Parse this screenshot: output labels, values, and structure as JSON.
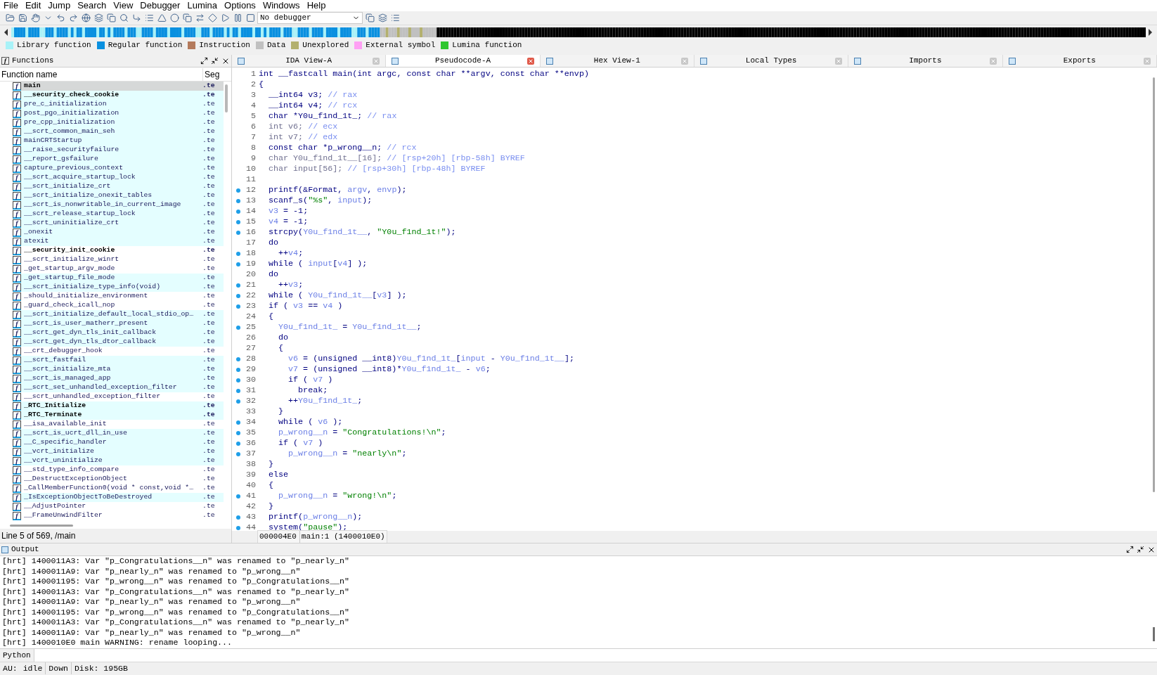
{
  "menu": [
    "File",
    "Edit",
    "Jump",
    "Search",
    "View",
    "Debugger",
    "Lumina",
    "Options",
    "Windows",
    "Help"
  ],
  "toolbar": {
    "debugger": "No debugger"
  },
  "legend": [
    {
      "label": "Library function",
      "color": "#a8f2f8"
    },
    {
      "label": "Regular function",
      "color": "#0a90e0"
    },
    {
      "label": "Instruction",
      "color": "#b47a5c"
    },
    {
      "label": "Data",
      "color": "#c0c0c0"
    },
    {
      "label": "Unexplored",
      "color": "#b3b06e"
    },
    {
      "label": "External symbol",
      "color": "#ffa0f4"
    },
    {
      "label": "Lumina function",
      "color": "#2ec62e"
    }
  ],
  "functions_panel": {
    "title": "Functions",
    "glyph": "f",
    "columns": [
      "Function name",
      "Seg"
    ],
    "status": "Line 5 of 569, /main",
    "rows": [
      {
        "glyph": "f",
        "name": "main",
        "segment": ".te",
        "bold": true,
        "library": true,
        "selected": true
      },
      {
        "glyph": "f",
        "name": "__security_check_cookie",
        "segment": ".te",
        "bold": true,
        "library": true,
        "selected": false
      },
      {
        "glyph": "f",
        "name": "pre_c_initialization",
        "segment": ".te",
        "bold": false,
        "library": true,
        "selected": false
      },
      {
        "glyph": "f",
        "name": "post_pgo_initialization",
        "segment": ".te",
        "bold": false,
        "library": true,
        "selected": false
      },
      {
        "glyph": "f",
        "name": "pre_cpp_initialization",
        "segment": ".te",
        "bold": false,
        "library": true,
        "selected": false
      },
      {
        "glyph": "f",
        "name": "__scrt_common_main_seh",
        "segment": ".te",
        "bold": false,
        "library": true,
        "selected": false
      },
      {
        "glyph": "f",
        "name": "mainCRTStartup",
        "segment": ".te",
        "bold": false,
        "library": true,
        "selected": false
      },
      {
        "glyph": "f",
        "name": "__raise_securityfailure",
        "segment": ".te",
        "bold": false,
        "library": true,
        "selected": false
      },
      {
        "glyph": "f",
        "name": "__report_gsfailure",
        "segment": ".te",
        "bold": false,
        "library": true,
        "selected": false
      },
      {
        "glyph": "f",
        "name": "capture_previous_context",
        "segment": ".te",
        "bold": false,
        "library": true,
        "selected": false
      },
      {
        "glyph": "f",
        "name": "__scrt_acquire_startup_lock",
        "segment": ".te",
        "bold": false,
        "library": true,
        "selected": false
      },
      {
        "glyph": "f",
        "name": "__scrt_initialize_crt",
        "segment": ".te",
        "bold": false,
        "library": true,
        "selected": false
      },
      {
        "glyph": "f",
        "name": "__scrt_initialize_onexit_tables",
        "segment": ".te",
        "bold": false,
        "library": true,
        "selected": false
      },
      {
        "glyph": "f",
        "name": "__scrt_is_nonwritable_in_current_image",
        "segment": ".te",
        "bold": false,
        "library": true,
        "selected": false
      },
      {
        "glyph": "f",
        "name": "__scrt_release_startup_lock",
        "segment": ".te",
        "bold": false,
        "library": true,
        "selected": false
      },
      {
        "glyph": "f",
        "name": "__scrt_uninitialize_crt",
        "segment": ".te",
        "bold": false,
        "library": true,
        "selected": false
      },
      {
        "glyph": "f",
        "name": "_onexit",
        "segment": ".te",
        "bold": false,
        "library": true,
        "selected": false
      },
      {
        "glyph": "f",
        "name": "atexit",
        "segment": ".te",
        "bold": false,
        "library": true,
        "selected": false
      },
      {
        "glyph": "f",
        "name": "__security_init_cookie",
        "segment": ".te",
        "bold": true,
        "library": false,
        "selected": false
      },
      {
        "glyph": "f",
        "name": "__scrt_initialize_winrt",
        "segment": ".te",
        "bold": false,
        "library": false,
        "selected": false
      },
      {
        "glyph": "f",
        "name": "_get_startup_argv_mode",
        "segment": ".te",
        "bold": false,
        "library": false,
        "selected": false
      },
      {
        "glyph": "f",
        "name": "_get_startup_file_mode",
        "segment": ".te",
        "bold": false,
        "library": true,
        "selected": false
      },
      {
        "glyph": "f",
        "name": "__scrt_initialize_type_info(void)",
        "segment": ".te",
        "bold": false,
        "library": true,
        "selected": false
      },
      {
        "glyph": "f",
        "name": "_should_initialize_environment",
        "segment": ".te",
        "bold": false,
        "library": false,
        "selected": false
      },
      {
        "glyph": "f",
        "name": "_guard_check_icall_nop",
        "segment": ".te",
        "bold": false,
        "library": false,
        "selected": false
      },
      {
        "glyph": "f",
        "name": "__scrt_initialize_default_local_stdio_op…",
        "segment": ".te",
        "bold": false,
        "library": true,
        "selected": false
      },
      {
        "glyph": "f",
        "name": "__scrt_is_user_matherr_present",
        "segment": ".te",
        "bold": false,
        "library": true,
        "selected": false
      },
      {
        "glyph": "f",
        "name": "__scrt_get_dyn_tls_init_callback",
        "segment": ".te",
        "bold": false,
        "library": true,
        "selected": false
      },
      {
        "glyph": "f",
        "name": "__scrt_get_dyn_tls_dtor_callback",
        "segment": ".te",
        "bold": false,
        "library": true,
        "selected": false
      },
      {
        "glyph": "f",
        "name": "__crt_debugger_hook",
        "segment": ".te",
        "bold": false,
        "library": false,
        "selected": false
      },
      {
        "glyph": "f",
        "name": "__scrt_fastfail",
        "segment": ".te",
        "bold": false,
        "library": true,
        "selected": false
      },
      {
        "glyph": "f",
        "name": "__scrt_initialize_mta",
        "segment": ".te",
        "bold": false,
        "library": true,
        "selected": false
      },
      {
        "glyph": "f",
        "name": "__scrt_is_managed_app",
        "segment": ".te",
        "bold": false,
        "library": true,
        "selected": false
      },
      {
        "glyph": "f",
        "name": "__scrt_set_unhandled_exception_filter",
        "segment": ".te",
        "bold": false,
        "library": true,
        "selected": false
      },
      {
        "glyph": "f",
        "name": "__scrt_unhandled_exception_filter",
        "segment": ".te",
        "bold": false,
        "library": false,
        "selected": false
      },
      {
        "glyph": "f",
        "name": "_RTC_Initialize",
        "segment": ".te",
        "bold": true,
        "library": true,
        "selected": false
      },
      {
        "glyph": "f",
        "name": "_RTC_Terminate",
        "segment": ".te",
        "bold": true,
        "library": true,
        "selected": false
      },
      {
        "glyph": "f",
        "name": "__isa_available_init",
        "segment": ".te",
        "bold": false,
        "library": false,
        "selected": false
      },
      {
        "glyph": "f",
        "name": "__scrt_is_ucrt_dll_in_use",
        "segment": ".te",
        "bold": false,
        "library": true,
        "selected": false
      },
      {
        "glyph": "f",
        "name": "__C_specific_handler",
        "segment": ".te",
        "bold": false,
        "library": true,
        "selected": false
      },
      {
        "glyph": "f",
        "name": "__vcrt_initialize",
        "segment": ".te",
        "bold": false,
        "library": true,
        "selected": false
      },
      {
        "glyph": "f",
        "name": "__vcrt_uninitialize",
        "segment": ".te",
        "bold": false,
        "library": true,
        "selected": false
      },
      {
        "glyph": "f",
        "name": "__std_type_info_compare",
        "segment": ".te",
        "bold": false,
        "library": false,
        "selected": false
      },
      {
        "glyph": "f",
        "name": "__DestructExceptionObject",
        "segment": ".te",
        "bold": false,
        "library": false,
        "selected": false
      },
      {
        "glyph": "f",
        "name": "_CallMemberFunction0(void * const,void *…",
        "segment": ".te",
        "bold": false,
        "library": false,
        "selected": false
      },
      {
        "glyph": "f",
        "name": "_IsExceptionObjectToBeDestroyed",
        "segment": ".te",
        "bold": false,
        "library": true,
        "selected": false
      },
      {
        "glyph": "f",
        "name": "__AdjustPointer",
        "segment": ".te",
        "bold": false,
        "library": false,
        "selected": false
      },
      {
        "glyph": "f",
        "name": "__FrameUnwindFilter",
        "segment": ".te",
        "bold": false,
        "library": false,
        "selected": false
      }
    ]
  },
  "tabs": [
    {
      "label": "IDA View-A",
      "selected": false
    },
    {
      "label": "Pseudocode-A",
      "selected": true
    },
    {
      "label": "Hex View-1",
      "selected": false
    },
    {
      "label": "Local Types",
      "selected": false
    },
    {
      "label": "Imports",
      "selected": false
    },
    {
      "label": "Exports",
      "selected": false
    }
  ],
  "pseudocode": {
    "status": [
      "000004E0",
      "main:1 (1400010E0)"
    ],
    "lines": [
      {
        "number": "1",
        "breakpoint": false,
        "tokens": [
          {
            "kind": "code",
            "text": "int __fastcall main(int argc, const char **argv, const char **envp)"
          }
        ]
      },
      {
        "number": "2",
        "breakpoint": false,
        "tokens": [
          {
            "kind": "code",
            "text": "{"
          }
        ]
      },
      {
        "number": "3",
        "breakpoint": false,
        "tokens": [
          {
            "kind": "code",
            "text": "  __int64 v3; "
          },
          {
            "kind": "comment",
            "text": "// rax"
          }
        ]
      },
      {
        "number": "4",
        "breakpoint": false,
        "tokens": [
          {
            "kind": "code",
            "text": "  __int64 v4; "
          },
          {
            "kind": "comment",
            "text": "// rcx"
          }
        ]
      },
      {
        "number": "5",
        "breakpoint": false,
        "tokens": [
          {
            "kind": "code",
            "text": "  char *Y0u_f1nd_1t_; "
          },
          {
            "kind": "comment",
            "text": "// rax"
          }
        ]
      },
      {
        "number": "6",
        "breakpoint": false,
        "tokens": [
          {
            "kind": "unused",
            "text": "  int v6; "
          },
          {
            "kind": "comment",
            "text": "// ecx"
          }
        ]
      },
      {
        "number": "7",
        "breakpoint": false,
        "tokens": [
          {
            "kind": "unused",
            "text": "  int v7; "
          },
          {
            "kind": "comment",
            "text": "// edx"
          }
        ]
      },
      {
        "number": "8",
        "breakpoint": false,
        "tokens": [
          {
            "kind": "code",
            "text": "  const char *p_wrong__n; "
          },
          {
            "kind": "comment",
            "text": "// rcx"
          }
        ]
      },
      {
        "number": "9",
        "breakpoint": false,
        "tokens": [
          {
            "kind": "unused",
            "text": "  char Y0u_f1nd_1t__[16]; "
          },
          {
            "kind": "comment",
            "text": "// [rsp+20h] [rbp-58h] BYREF"
          }
        ]
      },
      {
        "number": "10",
        "breakpoint": false,
        "tokens": [
          {
            "kind": "unused",
            "text": "  char input[56]; "
          },
          {
            "kind": "comment",
            "text": "// [rsp+30h] [rbp-48h] BYREF"
          }
        ]
      },
      {
        "number": "11",
        "breakpoint": false
      },
      {
        "number": "12",
        "breakpoint": true,
        "tokens": [
          {
            "kind": "code",
            "text": "  printf(&Format, "
          },
          {
            "kind": "var",
            "text": "argv"
          },
          {
            "kind": "code",
            "text": ", "
          },
          {
            "kind": "var",
            "text": "envp"
          },
          {
            "kind": "code",
            "text": ");"
          }
        ]
      },
      {
        "number": "13",
        "breakpoint": true,
        "tokens": [
          {
            "kind": "code",
            "text": "  scanf_s("
          },
          {
            "kind": "string",
            "text": "\"%s\""
          },
          {
            "kind": "code",
            "text": ", "
          },
          {
            "kind": "var",
            "text": "input"
          },
          {
            "kind": "code",
            "text": ");"
          }
        ]
      },
      {
        "number": "14",
        "breakpoint": true,
        "tokens": [
          {
            "kind": "var",
            "text": "  v3"
          },
          {
            "kind": "code",
            "text": " = -1;"
          }
        ]
      },
      {
        "number": "15",
        "breakpoint": true,
        "tokens": [
          {
            "kind": "var",
            "text": "  v4"
          },
          {
            "kind": "code",
            "text": " = -1;"
          }
        ]
      },
      {
        "number": "16",
        "breakpoint": true,
        "tokens": [
          {
            "kind": "code",
            "text": "  strcpy("
          },
          {
            "kind": "var",
            "text": "Y0u_f1nd_1t__"
          },
          {
            "kind": "code",
            "text": ", "
          },
          {
            "kind": "string",
            "text": "\"Y0u_f1nd_1t!\""
          },
          {
            "kind": "code",
            "text": ");"
          }
        ]
      },
      {
        "number": "17",
        "breakpoint": false,
        "tokens": [
          {
            "kind": "code",
            "text": "  do"
          }
        ]
      },
      {
        "number": "18",
        "breakpoint": true,
        "tokens": [
          {
            "kind": "code",
            "text": "    ++"
          },
          {
            "kind": "var",
            "text": "v4"
          },
          {
            "kind": "code",
            "text": ";"
          }
        ]
      },
      {
        "number": "19",
        "breakpoint": true,
        "tokens": [
          {
            "kind": "code",
            "text": "  while ( "
          },
          {
            "kind": "var",
            "text": "input"
          },
          {
            "kind": "code",
            "text": "["
          },
          {
            "kind": "var",
            "text": "v4"
          },
          {
            "kind": "code",
            "text": "] );"
          }
        ]
      },
      {
        "number": "20",
        "breakpoint": false,
        "tokens": [
          {
            "kind": "code",
            "text": "  do"
          }
        ]
      },
      {
        "number": "21",
        "breakpoint": true,
        "tokens": [
          {
            "kind": "code",
            "text": "    ++"
          },
          {
            "kind": "var",
            "text": "v3"
          },
          {
            "kind": "code",
            "text": ";"
          }
        ]
      },
      {
        "number": "22",
        "breakpoint": true,
        "tokens": [
          {
            "kind": "code",
            "text": "  while ( "
          },
          {
            "kind": "var",
            "text": "Y0u_f1nd_1t__"
          },
          {
            "kind": "code",
            "text": "["
          },
          {
            "kind": "var",
            "text": "v3"
          },
          {
            "kind": "code",
            "text": "] );"
          }
        ]
      },
      {
        "number": "23",
        "breakpoint": true,
        "tokens": [
          {
            "kind": "code",
            "text": "  if ( "
          },
          {
            "kind": "var",
            "text": "v3"
          },
          {
            "kind": "code",
            "text": " == "
          },
          {
            "kind": "var",
            "text": "v4"
          },
          {
            "kind": "code",
            "text": " )"
          }
        ]
      },
      {
        "number": "24",
        "breakpoint": false,
        "tokens": [
          {
            "kind": "code",
            "text": "  {"
          }
        ]
      },
      {
        "number": "25",
        "breakpoint": true,
        "tokens": [
          {
            "kind": "var",
            "text": "    Y0u_f1nd_1t_"
          },
          {
            "kind": "code",
            "text": " = "
          },
          {
            "kind": "var",
            "text": "Y0u_f1nd_1t__"
          },
          {
            "kind": "code",
            "text": ";"
          }
        ]
      },
      {
        "number": "26",
        "breakpoint": false,
        "tokens": [
          {
            "kind": "code",
            "text": "    do"
          }
        ]
      },
      {
        "number": "27",
        "breakpoint": false,
        "tokens": [
          {
            "kind": "code",
            "text": "    {"
          }
        ]
      },
      {
        "number": "28",
        "breakpoint": true,
        "tokens": [
          {
            "kind": "var",
            "text": "      v6"
          },
          {
            "kind": "code",
            "text": " = (unsigned __int8)"
          },
          {
            "kind": "var",
            "text": "Y0u_f1nd_1t_"
          },
          {
            "kind": "code",
            "text": "["
          },
          {
            "kind": "var",
            "text": "input"
          },
          {
            "kind": "code",
            "text": " - "
          },
          {
            "kind": "var",
            "text": "Y0u_f1nd_1t__"
          },
          {
            "kind": "code",
            "text": "];"
          }
        ]
      },
      {
        "number": "29",
        "breakpoint": true,
        "tokens": [
          {
            "kind": "var",
            "text": "      v7"
          },
          {
            "kind": "code",
            "text": " = (unsigned __int8)*"
          },
          {
            "kind": "var",
            "text": "Y0u_f1nd_1t_"
          },
          {
            "kind": "code",
            "text": " - "
          },
          {
            "kind": "var",
            "text": "v6"
          },
          {
            "kind": "code",
            "text": ";"
          }
        ]
      },
      {
        "number": "30",
        "breakpoint": true,
        "tokens": [
          {
            "kind": "code",
            "text": "      if ( "
          },
          {
            "kind": "var",
            "text": "v7"
          },
          {
            "kind": "code",
            "text": " )"
          }
        ]
      },
      {
        "number": "31",
        "breakpoint": true,
        "tokens": [
          {
            "kind": "code",
            "text": "        break;"
          }
        ]
      },
      {
        "number": "32",
        "breakpoint": true,
        "tokens": [
          {
            "kind": "code",
            "text": "      ++"
          },
          {
            "kind": "var",
            "text": "Y0u_f1nd_1t_"
          },
          {
            "kind": "code",
            "text": ";"
          }
        ]
      },
      {
        "number": "33",
        "breakpoint": false,
        "tokens": [
          {
            "kind": "code",
            "text": "    }"
          }
        ]
      },
      {
        "number": "34",
        "breakpoint": true,
        "tokens": [
          {
            "kind": "code",
            "text": "    while ( "
          },
          {
            "kind": "var",
            "text": "v6"
          },
          {
            "kind": "code",
            "text": " );"
          }
        ]
      },
      {
        "number": "35",
        "breakpoint": true,
        "tokens": [
          {
            "kind": "var",
            "text": "    p_wrong__n"
          },
          {
            "kind": "code",
            "text": " = "
          },
          {
            "kind": "string",
            "text": "\"Congratulations!\\n\""
          },
          {
            "kind": "code",
            "text": ";"
          }
        ]
      },
      {
        "number": "36",
        "breakpoint": true,
        "tokens": [
          {
            "kind": "code",
            "text": "    if ( "
          },
          {
            "kind": "var",
            "text": "v7"
          },
          {
            "kind": "code",
            "text": " )"
          }
        ]
      },
      {
        "number": "37",
        "breakpoint": true,
        "tokens": [
          {
            "kind": "var",
            "text": "      p_wrong__n"
          },
          {
            "kind": "code",
            "text": " = "
          },
          {
            "kind": "string",
            "text": "\"nearly\\n\""
          },
          {
            "kind": "code",
            "text": ";"
          }
        ]
      },
      {
        "number": "38",
        "breakpoint": false,
        "tokens": [
          {
            "kind": "code",
            "text": "  }"
          }
        ]
      },
      {
        "number": "39",
        "breakpoint": false,
        "tokens": [
          {
            "kind": "code",
            "text": "  else"
          }
        ]
      },
      {
        "number": "40",
        "breakpoint": false,
        "tokens": [
          {
            "kind": "code",
            "text": "  {"
          }
        ]
      },
      {
        "number": "41",
        "breakpoint": true,
        "tokens": [
          {
            "kind": "var",
            "text": "    p_wrong__n"
          },
          {
            "kind": "code",
            "text": " = "
          },
          {
            "kind": "string",
            "text": "\"wrong!\\n\""
          },
          {
            "kind": "code",
            "text": ";"
          }
        ]
      },
      {
        "number": "42",
        "breakpoint": false,
        "tokens": [
          {
            "kind": "code",
            "text": "  }"
          }
        ]
      },
      {
        "number": "43",
        "breakpoint": true,
        "tokens": [
          {
            "kind": "code",
            "text": "  printf("
          },
          {
            "kind": "var",
            "text": "p_wrong__n"
          },
          {
            "kind": "code",
            "text": ");"
          }
        ]
      },
      {
        "number": "44",
        "breakpoint": true,
        "tokens": [
          {
            "kind": "code",
            "text": "  system("
          },
          {
            "kind": "string",
            "text": "\"pause\""
          },
          {
            "kind": "code",
            "text": ");"
          }
        ]
      }
    ]
  },
  "output": {
    "title": "Output",
    "lines": [
      "[hrt] 1400011A3: Var \"p_Congratulations__n\" was renamed to \"p_nearly_n\"",
      "[hrt] 1400011A9: Var \"p_nearly_n\" was renamed to \"p_wrong__n\"",
      "[hrt] 140001195: Var \"p_wrong__n\" was renamed to \"p_Congratulations__n\"",
      "[hrt] 1400011A3: Var \"p_Congratulations__n\" was renamed to \"p_nearly_n\"",
      "[hrt] 1400011A9: Var \"p_nearly_n\" was renamed to \"p_wrong__n\"",
      "[hrt] 140001195: Var \"p_wrong__n\" was renamed to \"p_Congratulations__n\"",
      "[hrt] 1400011A3: Var \"p_Congratulations__n\" was renamed to \"p_nearly_n\"",
      "[hrt] 1400011A9: Var \"p_nearly_n\" was renamed to \"p_wrong__n\"",
      "[hrt] 1400010E0 main WARNING: rename looping..."
    ]
  },
  "python": {
    "label": "Python"
  },
  "status_bar": [
    "AU:",
    "idle",
    "Down",
    "Disk: 195GB"
  ]
}
